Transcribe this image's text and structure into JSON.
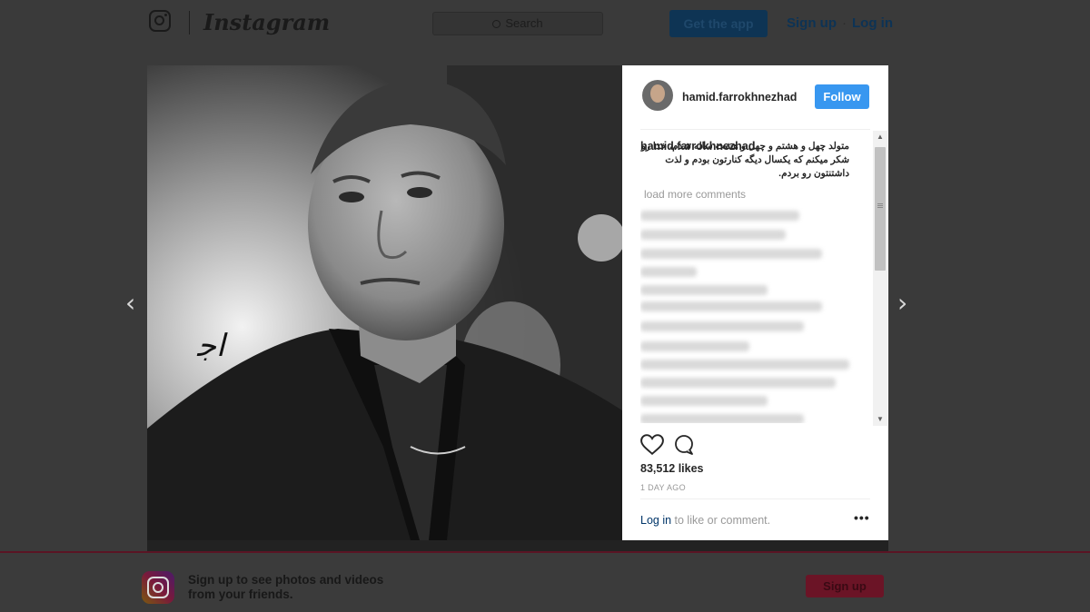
{
  "header": {
    "wordmark": "Instagram",
    "search_placeholder": "Search",
    "get_app_label": "Get the app",
    "signup_label": "Sign up",
    "login_label": "Log in",
    "separator": "·"
  },
  "nav_arrows": {
    "prev": "‹",
    "next": "›"
  },
  "post": {
    "username": "hamid.farrokhnezhad",
    "follow_label": "Follow",
    "caption_username": "hamid.farrokhnezhad",
    "caption_text": "متولد چهل و هشتم و چهل و هشت ساله شدم، خدا رو شکر میکنم که یکسال دیگه کنارتون بودم و لذت داشتنتون رو بردم.",
    "load_more_label": "load more comments",
    "likes": "83,512 likes",
    "time": "1 DAY AGO",
    "login_link": "Log in",
    "login_suffix": " to like or comment.",
    "more_label": "•••"
  },
  "bottom_bar": {
    "text": "Sign up to see photos and videos from your friends.",
    "signup_label": "Sign up"
  },
  "icons": {
    "logo": "instagram-camera-icon",
    "search": "search-icon",
    "like": "heart-icon",
    "comment": "comment-icon",
    "more": "more-options-icon"
  },
  "colors": {
    "follow_blue": "#3897f0",
    "overlay": "#3a3a3a",
    "link": "#003569"
  }
}
